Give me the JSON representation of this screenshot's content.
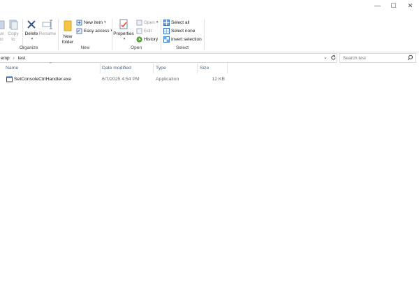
{
  "window": {
    "minimize_glyph": "—",
    "maximize_glyph": "☐",
    "close_glyph": "✕"
  },
  "ribbon": {
    "groups": {
      "organize": "Organize",
      "new": "New",
      "open": "Open",
      "select": "Select"
    },
    "buttons": {
      "move_to_line1": "ve",
      "move_to_line2": "to",
      "copy_to_line1": "Copy",
      "copy_to_line2": "to",
      "delete": "Delete",
      "rename": "Rename",
      "new_folder_line1": "New",
      "new_folder_line2": "folder",
      "new_item": "New item",
      "easy_access": "Easy access",
      "properties": "Properties",
      "open": "Open",
      "edit": "Edit",
      "history": "History",
      "select_all": "Select all",
      "select_none": "Select none",
      "invert_selection": "Invert selection"
    },
    "caret": "▾"
  },
  "address": {
    "crumbs": [
      "emp",
      "test"
    ],
    "separator": "›",
    "search_placeholder": "Search test"
  },
  "columns": {
    "name": "Name",
    "date_modified": "Date modified",
    "type": "Type",
    "size": "Size"
  },
  "files": [
    {
      "name": "SetConsoleCtrlHandler.exe",
      "date_modified": "6/7/2025 4:54 PM",
      "type": "Application",
      "size": "12 KB"
    }
  ],
  "colors": {
    "accent": "#0078d7",
    "folder": "#f4c542",
    "header_text": "#4c607a"
  }
}
